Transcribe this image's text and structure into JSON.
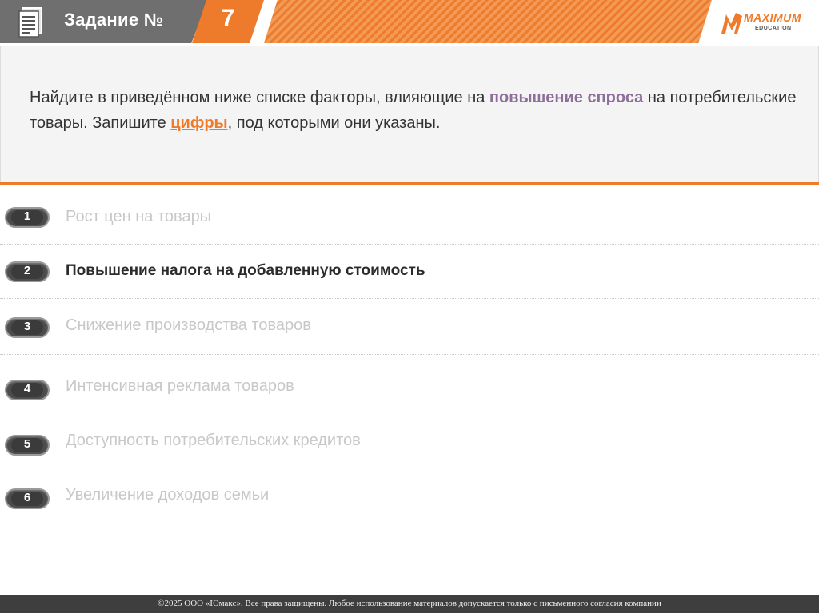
{
  "header": {
    "title": "Задание №",
    "number": "7",
    "logo_text": "MAXIMUM",
    "logo_sub": "EDUCATION",
    "icons": {
      "document": "document-icon",
      "logo_mark": "maximum-logo-icon"
    },
    "colors": {
      "accent": "#ee7b2b",
      "header_gray": "#6f6f6f"
    }
  },
  "question": {
    "part1": "Найдите в приведённом ниже списке факторы, влияющие на ",
    "accent1": "повышение спроса",
    "part2": " на потребительские товары. Запишите ",
    "accent2": "цифры",
    "part3": ", под которыми они указаны.",
    "colors": {
      "accent1": "#8d7099",
      "accent2": "#ee7b2b"
    }
  },
  "options": [
    {
      "num": "1",
      "label": "Рост цен на товары",
      "active": false
    },
    {
      "num": "2",
      "label": "Повышение налога на добавленную стоимость",
      "active": true
    },
    {
      "num": "3",
      "label": "Снижение производства товаров",
      "active": false
    },
    {
      "num": "4",
      "label": "Интенсивная реклама товаров",
      "active": false
    },
    {
      "num": "5",
      "label": "Доступность потребительских кредитов",
      "active": false
    },
    {
      "num": "6",
      "label": "Увеличение доходов семьи",
      "active": false
    }
  ],
  "footer": {
    "text": "©2025 ООО «Юмакс». Все права защищены. Любое использование материалов допускается только с  письменного согласия компании"
  }
}
